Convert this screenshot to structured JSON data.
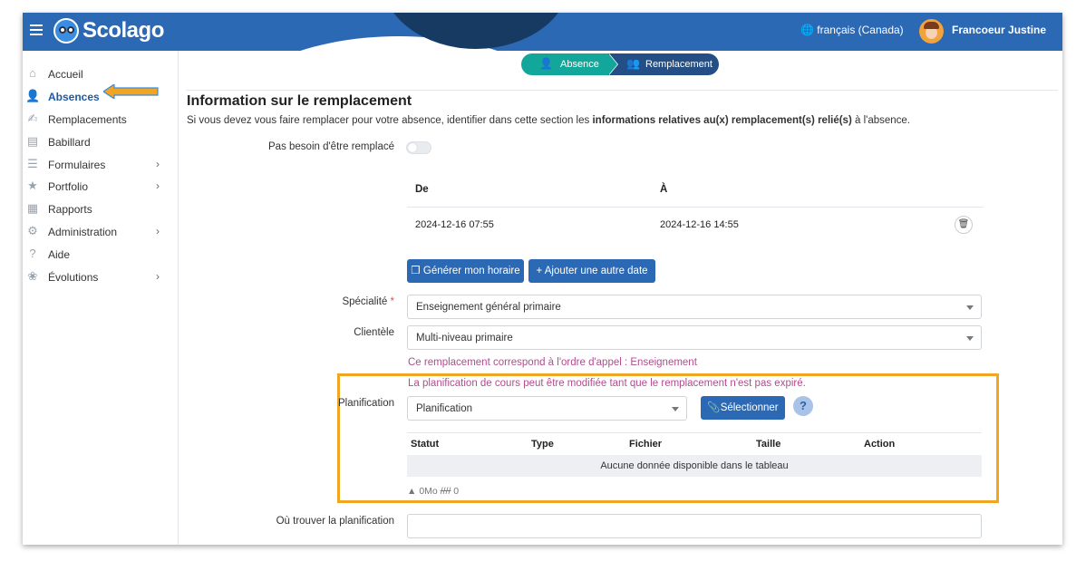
{
  "header": {
    "app_name": "Scolago",
    "language": "français (Canada)",
    "user_name": "Francoeur Justine"
  },
  "sidebar": {
    "items": [
      {
        "label": "Accueil",
        "icon": "home-icon",
        "has_children": false
      },
      {
        "label": "Absences",
        "icon": "person-absence-icon",
        "has_children": false,
        "active": true
      },
      {
        "label": "Remplacements",
        "icon": "handshake-icon",
        "has_children": false
      },
      {
        "label": "Babillard",
        "icon": "board-icon",
        "has_children": false
      },
      {
        "label": "Formulaires",
        "icon": "form-icon",
        "has_children": true
      },
      {
        "label": "Portfolio",
        "icon": "trophy-icon",
        "has_children": true
      },
      {
        "label": "Rapports",
        "icon": "report-icon",
        "has_children": false
      },
      {
        "label": "Administration",
        "icon": "gear-icon",
        "has_children": true
      },
      {
        "label": "Aide",
        "icon": "question-icon",
        "has_children": false
      },
      {
        "label": "Évolutions",
        "icon": "sprout-icon",
        "has_children": true
      }
    ]
  },
  "stepper": {
    "step1": "Absence",
    "step2": "Remplacement"
  },
  "section": {
    "title": "Information sur le remplacement",
    "desc_pre": "Si vous devez vous faire remplacer pour votre absence, identifier dans cette section les ",
    "desc_bold": "informations relatives au(x) remplacement(s) relié(s)",
    "desc_post": " à l'absence."
  },
  "no_replacement": {
    "label": "Pas besoin d'être remplacé"
  },
  "dates_table": {
    "col_from": "De",
    "col_to": "À",
    "rows": [
      {
        "from": "2024-12-16 07:55",
        "to": "2024-12-16 14:55"
      }
    ]
  },
  "buttons": {
    "generate": "Générer mon horaire",
    "add_date": "Ajouter une autre date",
    "select": "Sélectionner"
  },
  "form": {
    "speciality_label": "Spécialité",
    "speciality_required": "*",
    "speciality_value": "Enseignement général primaire",
    "clientele_label": "Clientèle",
    "clientele_value": "Multi-niveau primaire",
    "order_note": "Ce remplacement correspond à l'ordre d'appel : Enseignement",
    "planning_note": "La planification de cours peut être modifiée tant que le remplacement n'est pas expiré.",
    "planning_label": "Planification",
    "planning_value": "Planification",
    "where_label": "Où trouver la planification",
    "help": "?"
  },
  "planning_table": {
    "columns": [
      "Statut",
      "Type",
      "Fichier",
      "Taille",
      "Action"
    ],
    "empty_text": "Aucune donnée disponible dans le tableau",
    "size_stat": "0Mo",
    "count_stat": "0"
  },
  "colors": {
    "brand": "#2c69b5",
    "step_active": "#13a79b",
    "step_current": "#234f86",
    "highlight": "#f0a523",
    "note": "#b24c8e"
  }
}
